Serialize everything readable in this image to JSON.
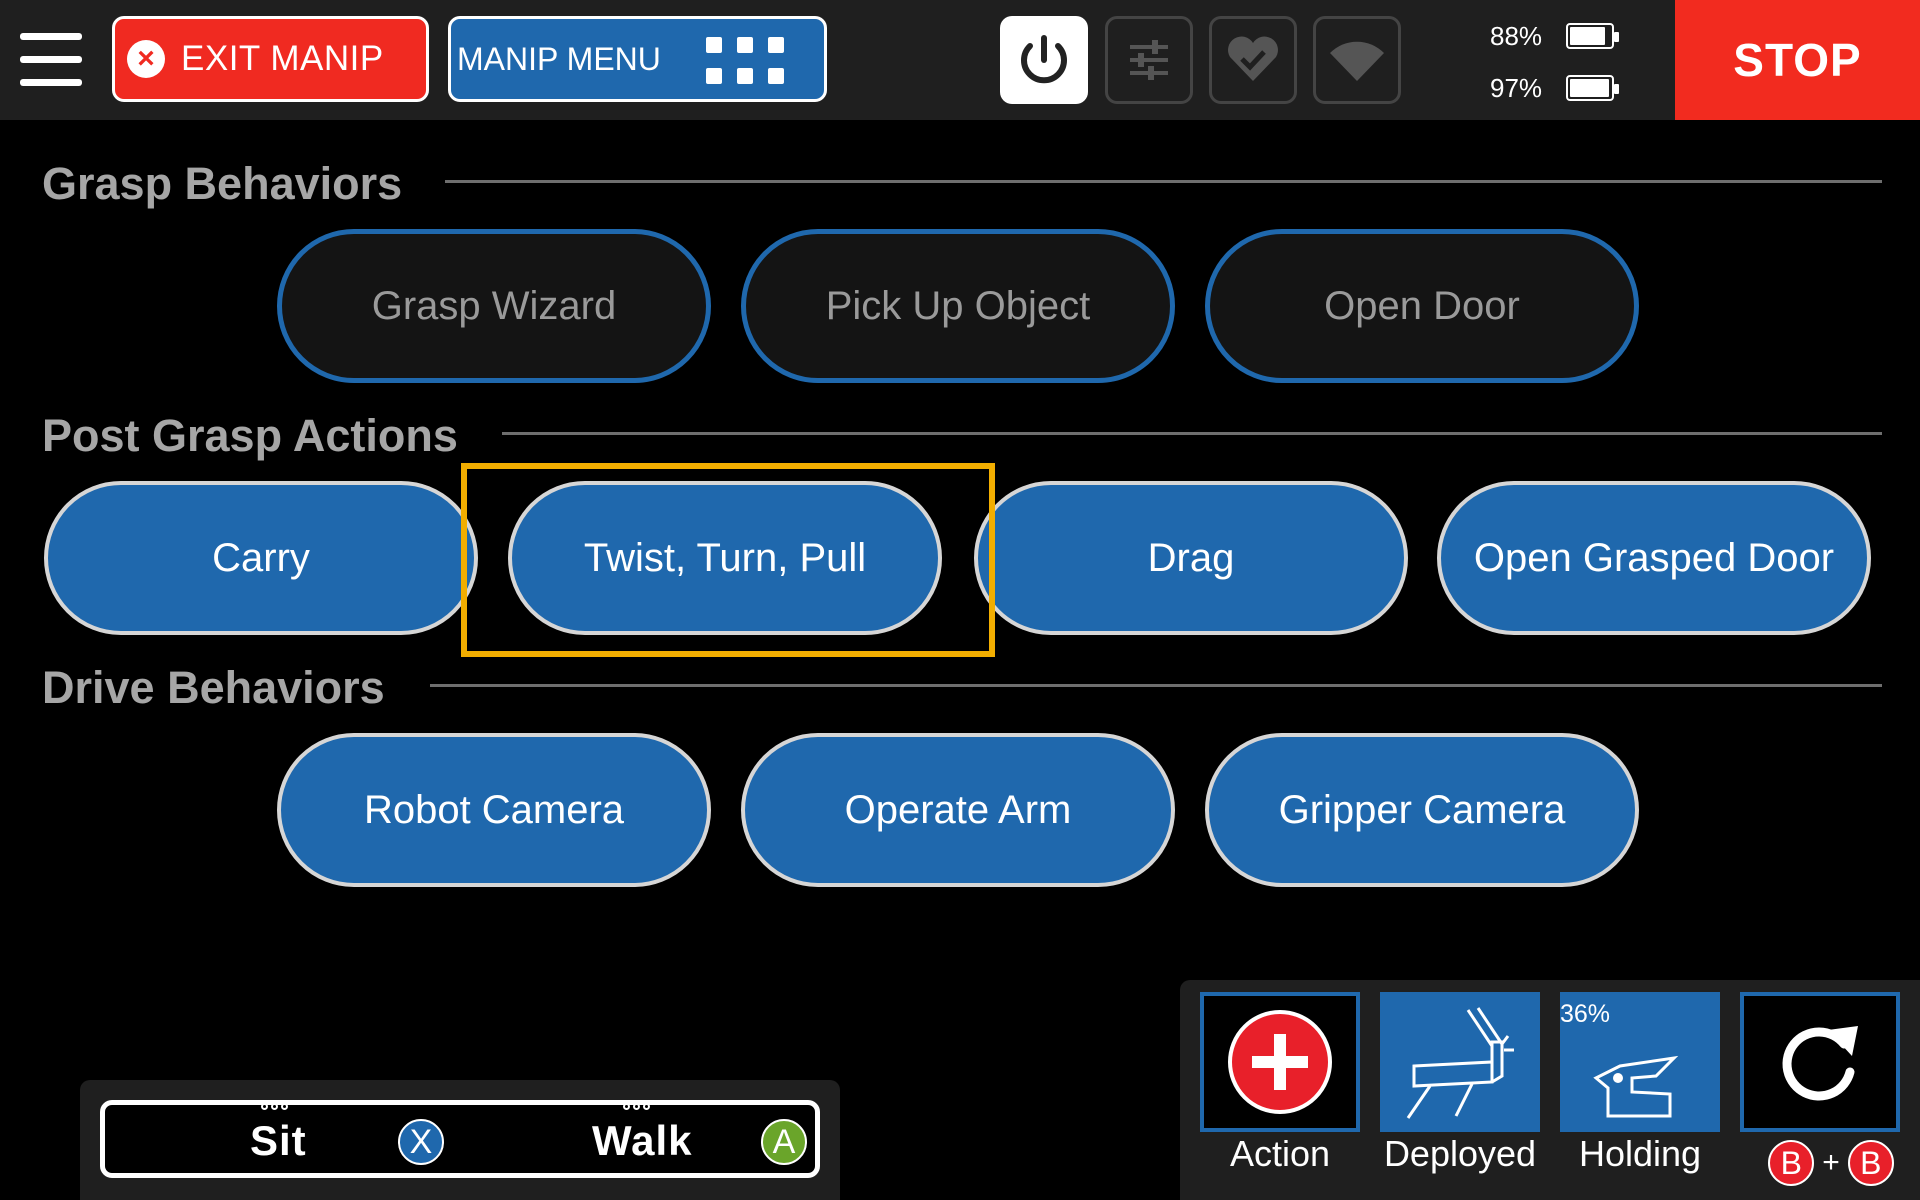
{
  "topbar": {
    "exit_label": "EXIT MANIP",
    "exit_icon": "×",
    "manip_menu_label": "MANIP MENU",
    "batteries": [
      {
        "percent": "88%",
        "level": 0.88
      },
      {
        "percent": "97%",
        "level": 0.97
      }
    ],
    "stop_label": "STOP"
  },
  "sections": {
    "grasp": {
      "title": "Grasp Behaviors",
      "buttons": [
        "Grasp Wizard",
        "Pick Up Object",
        "Open Door"
      ]
    },
    "post": {
      "title": "Post Grasp Actions",
      "buttons": [
        "Carry",
        "Twist, Turn, Pull",
        "Drag",
        "Open Grasped Door"
      ]
    },
    "drive": {
      "title": "Drive Behaviors",
      "buttons": [
        "Robot Camera",
        "Operate Arm",
        "Gripper Camera"
      ]
    }
  },
  "gait": {
    "sit_label": "Sit",
    "sit_key": "X",
    "walk_label": "Walk",
    "walk_key": "A",
    "sit_key_color": "#1f68ad",
    "walk_key_color": "#6aa52a"
  },
  "tiles": {
    "action_label": "Action",
    "deployed_label": "Deployed",
    "holding_label": "Holding",
    "holding_percent": "36%",
    "combo_key": "B",
    "combo_plus": "+"
  },
  "colors": {
    "accent_blue": "#1f68ad",
    "stop_red": "#f22b1f",
    "highlight": "#f2ae00"
  }
}
